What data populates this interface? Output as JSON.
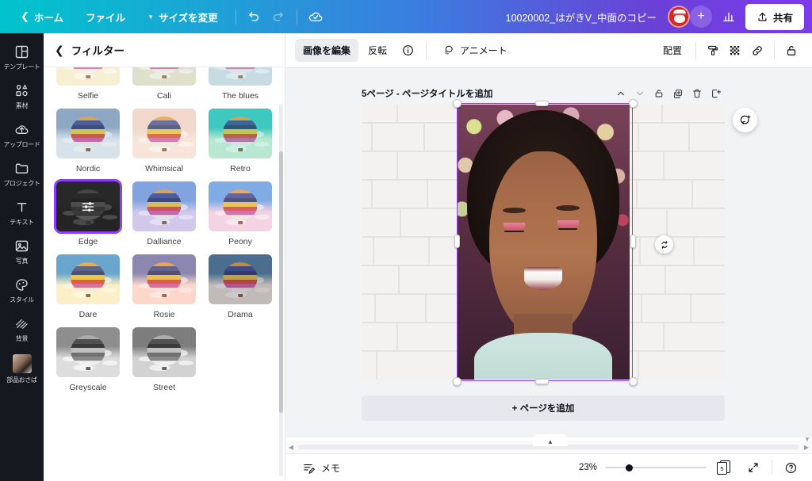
{
  "topbar": {
    "home_label": "ホーム",
    "file_label": "ファイル",
    "resize_label": "サイズを変更",
    "undo_icon": "undo-icon",
    "redo_icon": "redo-icon",
    "cloud_icon": "cloud-saved-icon",
    "doc_title": "10020002_はがきV_中面のコピー",
    "add_collab_label": "+",
    "stats_icon": "bar-chart-icon",
    "share_label": "共有",
    "share_icon": "upload-icon"
  },
  "sidebar": {
    "items": [
      {
        "label": "テンプレート",
        "icon": "template-icon"
      },
      {
        "label": "素材",
        "icon": "elements-icon"
      },
      {
        "label": "アップロード",
        "icon": "upload-cloud-icon"
      },
      {
        "label": "プロジェクト",
        "icon": "folder-icon"
      },
      {
        "label": "テキスト",
        "icon": "text-icon"
      },
      {
        "label": "写真",
        "icon": "photo-icon"
      },
      {
        "label": "スタイル",
        "icon": "palette-icon"
      },
      {
        "label": "背景",
        "icon": "background-icon"
      },
      {
        "label": "部品おさば",
        "icon": "app-thumbnail-icon"
      }
    ]
  },
  "panel": {
    "back_icon": "chevron-left-icon",
    "title": "フィルター",
    "selected_filter": "Edge",
    "filters": [
      {
        "name": "Selfie",
        "sky": "#f7efd2",
        "ground": "#f7efd2",
        "tint": "rgba(247,239,210,0.25)"
      },
      {
        "name": "Cali",
        "sky": "#dfe0cc",
        "ground": "#dfe0cc",
        "tint": "rgba(223,224,204,0.3)"
      },
      {
        "name": "The blues",
        "sky": "#cfdfe2",
        "ground": "#cfdfe2",
        "tint": "rgba(180,215,225,0.35)"
      },
      {
        "name": "Nordic",
        "sky": "#8fa8c4",
        "ground": "#e8eef3",
        "tint": "rgba(140,170,200,0.18)"
      },
      {
        "name": "Whimsical",
        "sky": "#f0d8cc",
        "ground": "#faeae0",
        "tint": "rgba(245,215,200,0.25)"
      },
      {
        "name": "Retro",
        "sky": "#3fc8c0",
        "ground": "#d8f0d8",
        "tint": "rgba(60,200,190,0.2)"
      },
      {
        "name": "Edge",
        "sky": "#4a4a4a",
        "ground": "#3a3a3a",
        "tint": "rgba(35,35,35,0.55)"
      },
      {
        "name": "Dalliance",
        "sky": "#7da7e0",
        "ground": "#ded4ef",
        "tint": "rgba(150,150,220,0.18)"
      },
      {
        "name": "Peony",
        "sky": "#63a8e8",
        "ground": "#f6d9e6",
        "tint": "rgba(240,190,215,0.2)"
      },
      {
        "name": "Dare",
        "sky": "#4d9bdd",
        "ground": "#fbf3d8",
        "tint": "rgba(255,220,120,0.16)"
      },
      {
        "name": "Rosie",
        "sky": "#6f7fb8",
        "ground": "#fde3d8",
        "tint": "rgba(255,170,150,0.2)"
      },
      {
        "name": "Drama",
        "sky": "#4c7fa0",
        "ground": "#e8e6d6",
        "tint": "rgba(70,60,90,0.25)"
      },
      {
        "name": "Greyscale",
        "sky": "#8e8e8e",
        "ground": "#dddddd",
        "tint": "rgba(128,128,128,0.0)"
      },
      {
        "name": "Street",
        "sky": "#7d7d7d",
        "ground": "#d2d2d2",
        "tint": "rgba(110,110,110,0.0)"
      }
    ]
  },
  "toolbar": {
    "edit_image_label": "画像を編集",
    "flip_label": "反転",
    "info_icon": "info-icon",
    "animate_label": "アニメート",
    "animate_icon": "animate-icon",
    "position_label": "配置",
    "paint_icon": "paint-roller-icon",
    "transparency_icon": "transparency-icon",
    "link_icon": "link-icon",
    "lock_icon": "lock-icon"
  },
  "canvas": {
    "page_label": "5ページ - ページタイトルを追加",
    "actions": [
      {
        "icon": "chevron-up-icon",
        "name": "move-page-up"
      },
      {
        "icon": "chevron-down-icon",
        "name": "move-page-down"
      },
      {
        "icon": "lock-icon",
        "name": "lock-page"
      },
      {
        "icon": "duplicate-icon",
        "name": "duplicate-page"
      },
      {
        "icon": "trash-icon",
        "name": "delete-page"
      },
      {
        "icon": "add-page-icon",
        "name": "add-page"
      }
    ],
    "rotate_icon": "rotate-handle-icon",
    "refresh_icon": "refresh-plus-icon",
    "add_page_label": "+ ページを追加",
    "selection_color": "#8b3dff"
  },
  "bottombar": {
    "notes_label": "メモ",
    "notes_icon": "notes-icon",
    "zoom_value": "23%",
    "page_count": "5",
    "pages_icon": "pages-icon",
    "fullscreen_icon": "expand-icon",
    "help_icon": "help-icon"
  }
}
